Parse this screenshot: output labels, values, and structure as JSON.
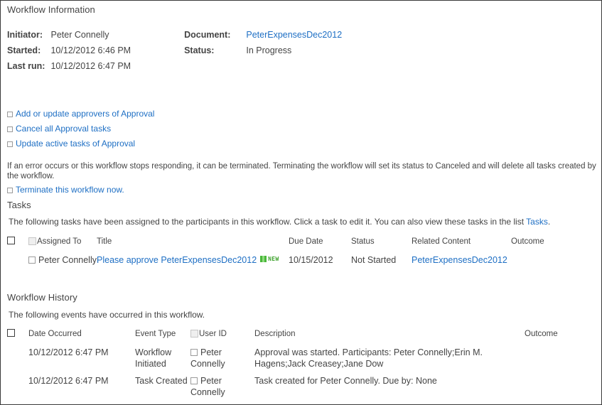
{
  "workflow_information": {
    "section_title": "Workflow Information",
    "fields": {
      "initiator_label": "Initiator:",
      "initiator_value": "Peter Connelly",
      "started_label": "Started:",
      "started_value": "10/12/2012 6:46 PM",
      "last_run_label": "Last run:",
      "last_run_value": "10/12/2012 6:47 PM",
      "document_label": "Document:",
      "document_value": "PeterExpensesDec2012",
      "status_label": "Status:",
      "status_value": "In Progress"
    }
  },
  "actions": [
    {
      "label": "Add or update approvers of Approval"
    },
    {
      "label": "Cancel all Approval tasks"
    },
    {
      "label": "Update active tasks of Approval"
    }
  ],
  "terminate": {
    "notice": "If an error occurs or this workflow stops responding, it can be terminated. Terminating the workflow will set its status to Canceled and will delete all tasks created by the workflow.",
    "link": "Terminate this workflow now."
  },
  "tasks": {
    "section_title": "Tasks",
    "description_before": "The following tasks have been assigned to the participants in this workflow. Click a task to edit it. You can also view these tasks in the list ",
    "description_link": "Tasks",
    "description_after": ".",
    "columns": {
      "assigned_to": "Assigned To",
      "title": "Title",
      "due_date": "Due Date",
      "status": "Status",
      "related_content": "Related Content",
      "outcome": "Outcome"
    },
    "rows": [
      {
        "assigned_to": "Peter Connelly",
        "title": "Please approve PeterExpensesDec2012",
        "badge": "NEW",
        "due_date": "10/15/2012",
        "status": "Not Started",
        "related_content": "PeterExpensesDec2012",
        "outcome": ""
      }
    ]
  },
  "workflow_history": {
    "section_title": "Workflow History",
    "description": "The following events have occurred in this workflow.",
    "columns": {
      "date_occurred": "Date Occurred",
      "event_type": "Event Type",
      "user_id": "User ID",
      "description": "Description",
      "outcome": "Outcome"
    },
    "rows": [
      {
        "date_occurred": "10/12/2012 6:47 PM",
        "event_type": "Workflow Initiated",
        "user_id": "Peter Connelly",
        "description": "Approval was started. Participants: Peter Connelly;Erin M. Hagens;Jack Creasey;Jane Dow",
        "outcome": ""
      },
      {
        "date_occurred": "10/12/2012 6:47 PM",
        "event_type": "Task Created",
        "user_id": "Peter Connelly",
        "description": "Task created for Peter Connelly. Due by: None",
        "outcome": ""
      }
    ]
  },
  "colors": {
    "link": "#1e6fc4",
    "text": "#444444",
    "badge_green": "#3fa32e",
    "border": "#3a3a3a"
  }
}
